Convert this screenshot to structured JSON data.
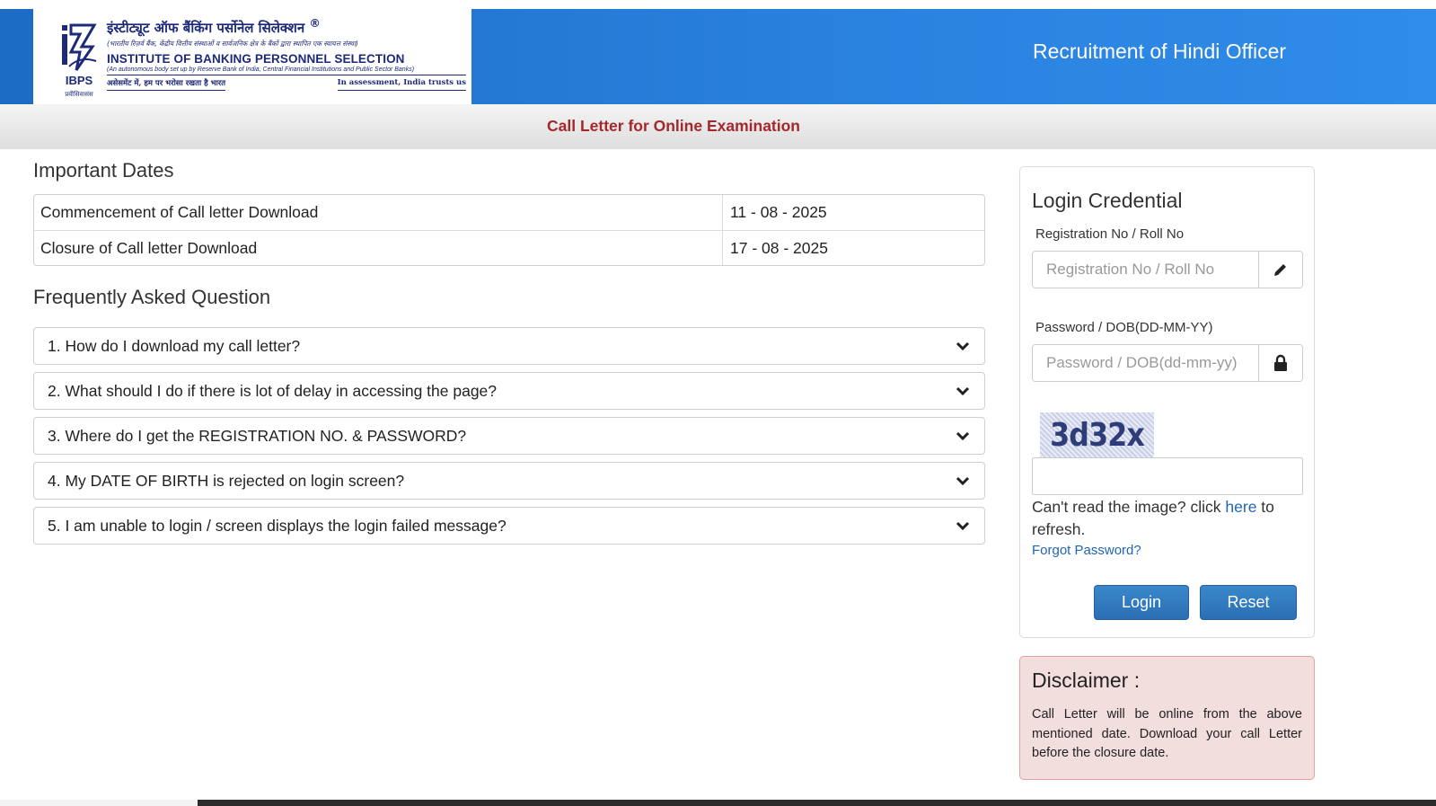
{
  "header": {
    "logo": {
      "hindi_name": "इंस्टीट्यूट ऑफ बैंकिंग पर्सोनेल सिलेक्शन",
      "registered": "®",
      "hindi_subtitle": "(भारतीय रिज़र्व बैंक, केंद्रीय वित्तीय संस्थाओं व सार्वजनिक क्षेत्र के बैंकों द्वारा स्थापित एक स्वायत्त संस्था)",
      "english_name": "INSTITUTE OF BANKING PERSONNEL SELECTION",
      "english_subtitle": "(An autonomous body set up by Reserve Bank of India, Central Financial Institutions and Public Sector Banks)",
      "tagline_hindi": "असेसमेंट में, हम पर भरोसा रखता है भारत",
      "tagline_english": "In assessment, India trusts us",
      "emblem_abbr": "IBPS",
      "emblem_hindi": "प्रवीसिवासंस"
    },
    "title": "Recruitment of Hindi Officer"
  },
  "subbar": {
    "title": "Call Letter for Online Examination"
  },
  "important_dates": {
    "heading": "Important Dates",
    "rows": [
      {
        "label": "Commencement of Call letter Download",
        "value": "11 - 08 - 2025"
      },
      {
        "label": "Closure of Call letter Download",
        "value": "17 - 08 - 2025"
      }
    ]
  },
  "faq": {
    "heading": "Frequently Asked Question",
    "items": [
      "1. How do I download my call letter?",
      "2. What should I do if there is lot of delay in accessing the page?",
      "3. Where do I get the REGISTRATION NO. & PASSWORD?",
      "4. My DATE OF BIRTH is rejected on login screen?",
      "5. I am unable to login / screen displays the login failed message?"
    ]
  },
  "login": {
    "title": "Login Credential",
    "reg_label": "Registration No / Roll No",
    "reg_placeholder": "Registration No / Roll No",
    "pwd_label": "Password / DOB(DD-MM-YY)",
    "pwd_placeholder": "Password / DOB(dd-mm-yy)",
    "captcha_text": "3d32x",
    "captcha_help_prefix": "Can't read the image? click ",
    "captcha_help_link": "here",
    "captcha_help_suffix": " to refresh.",
    "forgot_password": "Forgot Password?",
    "login_button": "Login",
    "reset_button": "Reset"
  },
  "disclaimer": {
    "title": "Disclaimer :",
    "text": "Call Letter will be online from the above mentioned date. Download your call Letter before the closure date."
  },
  "colors": {
    "header_blue": "#2a82df",
    "subtitle_red": "#a3282b",
    "button_blue": "#2b6fb3",
    "disclaimer_bg": "#f3dede",
    "disclaimer_border": "#e2a2a2"
  },
  "icons": {
    "reg_addon": "pencil-icon",
    "pwd_addon": "lock-icon",
    "faq_toggle": "chevron-down-icon"
  }
}
